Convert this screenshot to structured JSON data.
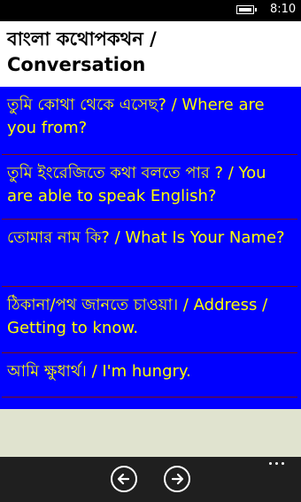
{
  "status_bar": {
    "time": "8:10",
    "battery_icon": "battery-icon"
  },
  "header": {
    "title": "বাংলা কথোপকথন / Conversation"
  },
  "phrases": [
    "তুমি কোথা থেকে এসেছ? / Where are you from?",
    "তুমি ইংরেজিতে কথা বলতে পার ? / You are able to speak English?",
    "তোমার নাম কি? / What Is Your Name?",
    "ঠিকানা/পথ জানতে চাওয়া। / Address / Getting to know.",
    "আমি ক্ষুধার্থ। / I'm hungry."
  ],
  "app_bar": {
    "back_icon": "arrow-left-icon",
    "forward_icon": "arrow-right-icon",
    "more_icon": "more-dots-icon"
  },
  "colors": {
    "list_background": "#0000ff",
    "phrase_text": "#ffff00",
    "divider": "#7a1010",
    "header_background": "#ffffff",
    "footer_background": "#e0e3cf",
    "app_bar_background": "#1f1f1f"
  }
}
